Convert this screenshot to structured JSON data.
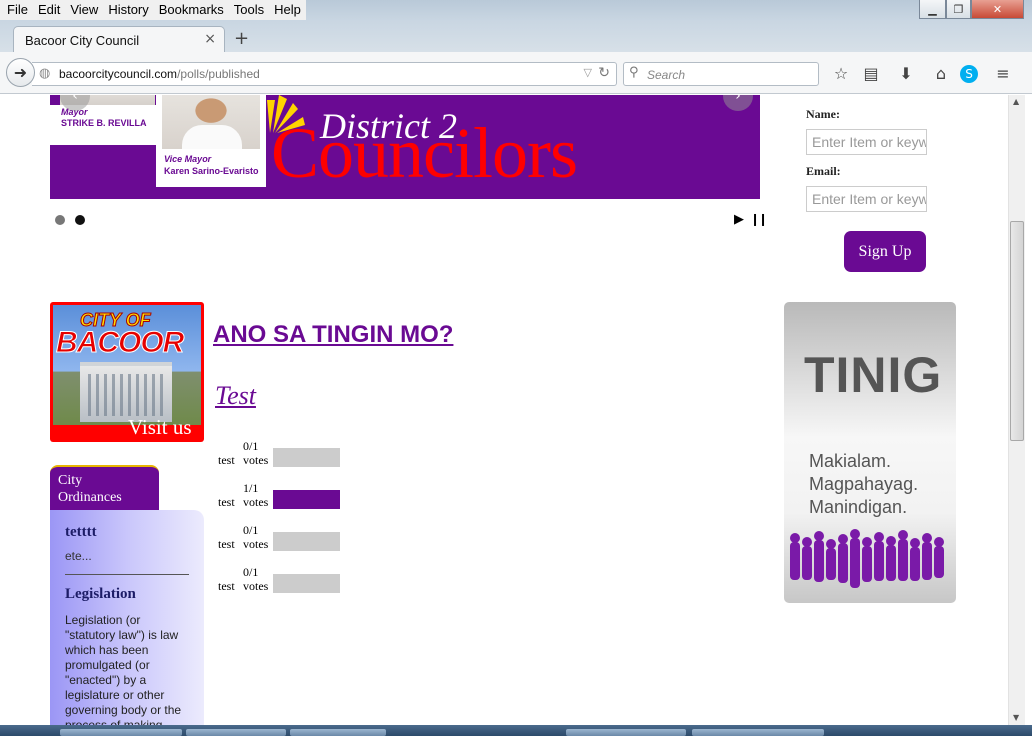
{
  "browser": {
    "menu": [
      "File",
      "Edit",
      "View",
      "History",
      "Bookmarks",
      "Tools",
      "Help"
    ],
    "tab_title": "Bacoor City Council",
    "new_tab": "+",
    "url_domain": "bacoorcitycouncil.com",
    "url_path": "/polls/published",
    "search_placeholder": "Search"
  },
  "banner": {
    "mayor_role": "Mayor",
    "mayor_name": "STRIKE B. REVILLA",
    "vice_mayor_role": "Vice Mayor",
    "vice_mayor_name": "Karen Sarino-Evaristo",
    "title_small": "District 2",
    "title_big": "Councilors"
  },
  "slideshow": {
    "active_dot": 2,
    "dot_count": 2
  },
  "newsletter": {
    "name_label": "Name:",
    "name_placeholder": "Enter Item or keyw",
    "email_label": "Email:",
    "email_placeholder": "Enter Item or keyw",
    "button": "Sign Up"
  },
  "ads": {
    "bacoor_line1": "CITY OF",
    "bacoor_line2": "BACOOR",
    "bacoor_visit": "Visit us",
    "tinig_title": "TINIG",
    "tinig_lines": [
      "Makialam.",
      "Magpahayag.",
      "Manindigan."
    ]
  },
  "sidebar": {
    "tab_label": "City Ordinances",
    "item1_title": "tetttt",
    "item1_excerpt": "ete...",
    "item2_title": "Legislation",
    "item2_body": "Legislation (or \"statutory law\") is law which has been promulgated (or \"enacted\") by a legislature or other governing body or the process of making"
  },
  "poll": {
    "question": "ANO SA TINGIN MO?",
    "title": "Test",
    "options": [
      {
        "label": "test",
        "fraction": "0/1",
        "votes_label": "votes",
        "share": 0
      },
      {
        "label": "test",
        "fraction": "1/1",
        "votes_label": "votes",
        "share": 1
      },
      {
        "label": "test",
        "fraction": "0/1",
        "votes_label": "votes",
        "share": 0
      },
      {
        "label": "test",
        "fraction": "0/1",
        "votes_label": "votes",
        "share": 0
      }
    ]
  },
  "colors": {
    "brand_purple": "#6a0a93",
    "accent_red": "#ff0000",
    "bar_empty": "#cccccc"
  }
}
